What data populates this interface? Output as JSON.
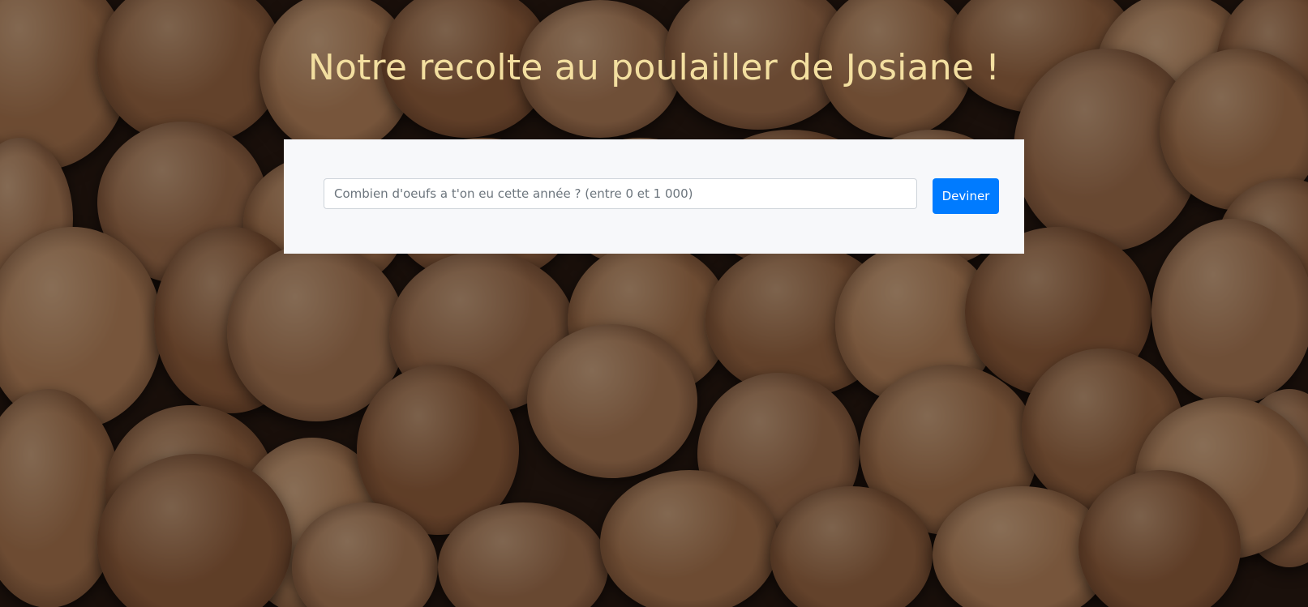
{
  "page": {
    "title": "Notre recolte au poulailler de Josiane !"
  },
  "form": {
    "input_placeholder": "Combien d'oeufs a t'on eu cette année ? (entre 0 et 1 000)",
    "input_value": "",
    "submit_label": "Deviner"
  },
  "colors": {
    "title": "#f3dfa0",
    "card_background": "#f7f8fa",
    "button_primary": "#007bff",
    "background_photo_tone": "#8a5a3a"
  }
}
